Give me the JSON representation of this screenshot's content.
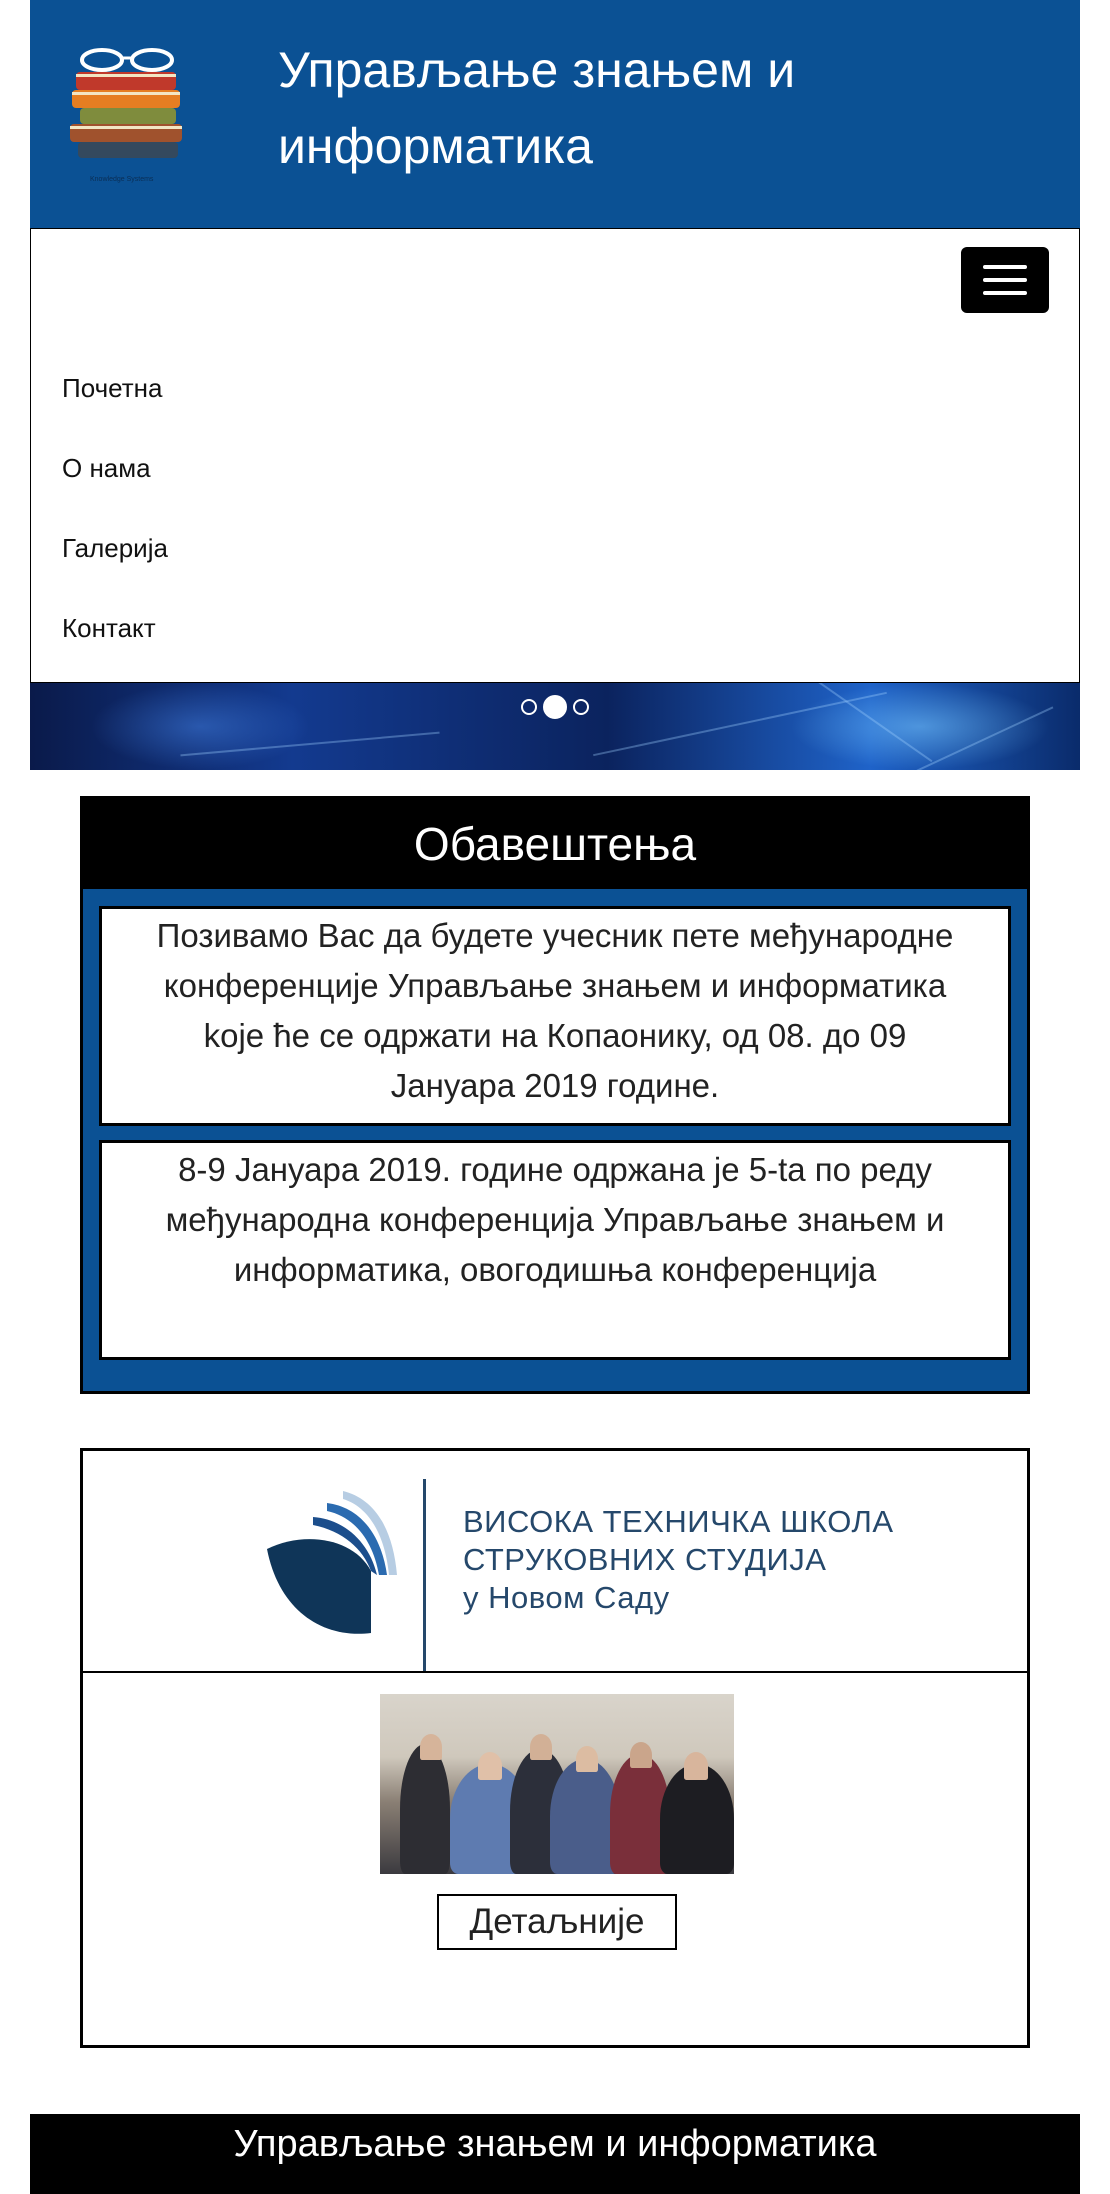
{
  "header": {
    "title": "Управљање знањем и информатика",
    "logo_icon": "books-with-glasses-logo",
    "logo_caption": "Knowledge Systems"
  },
  "navbar": {
    "toggler_icon": "hamburger-menu-icon",
    "items": [
      {
        "label": "Почетна"
      },
      {
        "label": "О нама"
      },
      {
        "label": "Галерија"
      },
      {
        "label": "Контакт"
      }
    ]
  },
  "carousel": {
    "slides": 3,
    "active_slide": 2
  },
  "notices": {
    "title": "Обавештења",
    "items": [
      {
        "text": "Позивамо Вас да будете учесник пете међународне конференције Управљање знањем и информатика koje ће се одржати на Копаонику, од 08. до 09 Јануара 2019 године."
      },
      {
        "text": "8-9 Јануара 2019. године одржана је 5-ta по реду међународна конференција Управљање знањем и информатика, овогодишња конференција"
      }
    ]
  },
  "card": {
    "school_logo_icon": "vts-novi-sad-logo",
    "school_lines": [
      "ВИСОКА ТЕХНИЧКА ШКОЛА",
      "СТРУКОВНИХ СТУДИЈА",
      "у Новом Саду"
    ],
    "photo": "conference-audience-photo",
    "button_label": "Детаљније"
  },
  "footer": {
    "title": "Управљање знањем и информатика"
  },
  "colors": {
    "brand_blue": "#0b5194",
    "black": "#000000",
    "white": "#ffffff",
    "school_navy": "#25486b"
  }
}
